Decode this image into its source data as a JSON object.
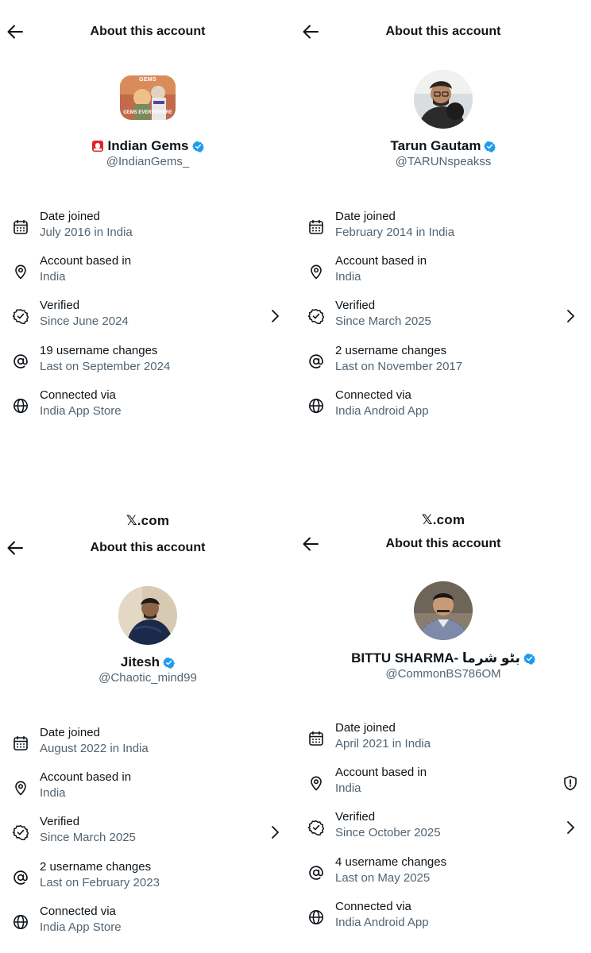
{
  "colors": {
    "text": "#0f1419",
    "secondary": "#536471",
    "verified": "#1d9bf0"
  },
  "panels": [
    {
      "title": "About this account",
      "name": "Indian Gems",
      "handle": "@IndianGems_",
      "avatar_text_top": "GEMS",
      "avatar_text_bottom": "GEMS EVERYWHERE",
      "rows": [
        {
          "icon": "calendar-icon",
          "label": "Date joined",
          "value": "July 2016 in India"
        },
        {
          "icon": "location-pin-icon",
          "label": "Account based in",
          "value": "India"
        },
        {
          "icon": "verified-check-icon",
          "label": "Verified",
          "value": "Since June 2024"
        },
        {
          "icon": "at-sign-icon",
          "label": "19 username changes",
          "value": "Last on September 2024"
        },
        {
          "icon": "globe-icon",
          "label": "Connected via",
          "value": "India App Store"
        }
      ]
    },
    {
      "title": "About this account",
      "name": "Tarun Gautam",
      "handle": "@TARUNspeakss",
      "rows": [
        {
          "icon": "calendar-icon",
          "label": "Date joined",
          "value": "February 2014 in India"
        },
        {
          "icon": "location-pin-icon",
          "label": "Account based in",
          "value": "India"
        },
        {
          "icon": "verified-check-icon",
          "label": "Verified",
          "value": "Since March 2025"
        },
        {
          "icon": "at-sign-icon",
          "label": "2 username changes",
          "value": "Last on November 2017"
        },
        {
          "icon": "globe-icon",
          "label": "Connected via",
          "value": "India Android App"
        }
      ]
    },
    {
      "site": "𝕏.com",
      "title": "About this account",
      "name": "Jitesh",
      "handle": "@Chaotic_mind99",
      "rows": [
        {
          "icon": "calendar-icon",
          "label": "Date joined",
          "value": "August 2022 in India"
        },
        {
          "icon": "location-pin-icon",
          "label": "Account based in",
          "value": "India"
        },
        {
          "icon": "verified-check-icon",
          "label": "Verified",
          "value": "Since March 2025"
        },
        {
          "icon": "at-sign-icon",
          "label": "2 username changes",
          "value": "Last on February 2023"
        },
        {
          "icon": "globe-icon",
          "label": "Connected via",
          "value": "India App Store"
        }
      ]
    },
    {
      "site": "𝕏.com",
      "title": "About this account",
      "name": "BITTU SHARMA- بٹو شرما",
      "handle": "@CommonBS786OM",
      "rows": [
        {
          "icon": "calendar-icon",
          "label": "Date joined",
          "value": "April 2021 in India"
        },
        {
          "icon": "location-pin-icon",
          "label": "Account based in",
          "value": "India"
        },
        {
          "icon": "verified-check-icon",
          "label": "Verified",
          "value": "Since October 2025"
        },
        {
          "icon": "at-sign-icon",
          "label": "4 username changes",
          "value": "Last on May 2025"
        },
        {
          "icon": "globe-icon",
          "label": "Connected via",
          "value": "India Android App"
        }
      ]
    }
  ]
}
